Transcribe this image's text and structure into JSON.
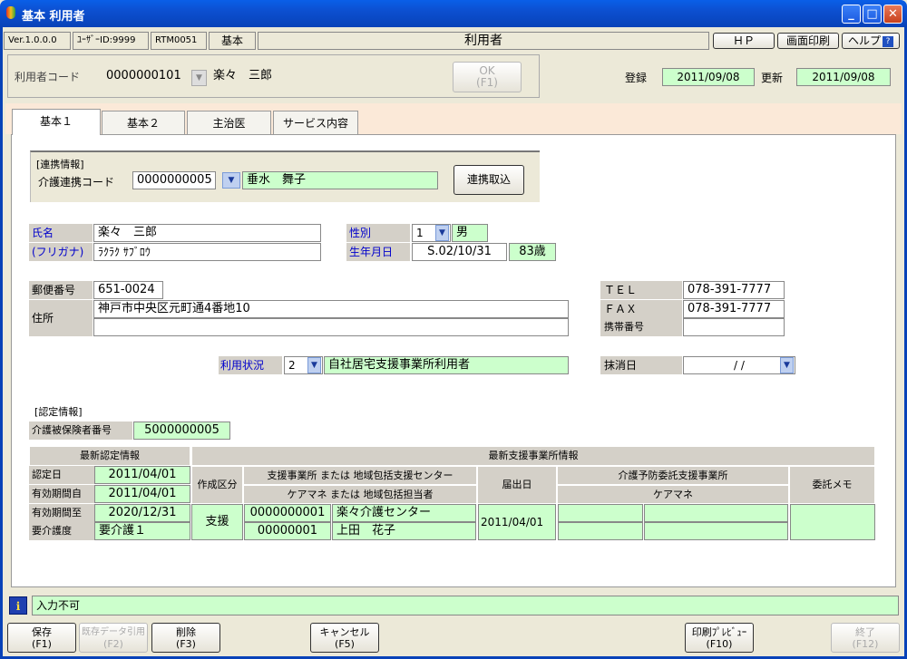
{
  "window": {
    "title": "基本 利用者"
  },
  "topbar": {
    "version": "Ver.1.0.0.0",
    "user_id": "ﾕｰｻﾞｰID:9999",
    "screen_code": "RTM0051",
    "category": "基本",
    "screen_name": "利用者",
    "hp": "ＨＰ",
    "print": "画面印刷",
    "help": "ヘルプ"
  },
  "header": {
    "user_code_label": "利用者コード",
    "user_code": "0000000101",
    "user_name": "楽々　三郎",
    "ok_label": "OK",
    "ok_key": "(F1)",
    "reg_label": "登録",
    "reg_date": "2011/09/08",
    "upd_label": "更新",
    "upd_date": "2011/09/08"
  },
  "tabs": [
    "基本１",
    "基本２",
    "主治医",
    "サービス内容"
  ],
  "renkei": {
    "group": "[連携情報]",
    "code_label": "介護連携コード",
    "code": "0000000005",
    "name": "垂水　舞子",
    "button": "連携取込"
  },
  "person": {
    "name_label": "氏名",
    "name": "楽々　三郎",
    "kana_label": "(フリガナ)",
    "kana": "ﾗｸﾗｸ ｻﾌﾞﾛｳ",
    "sex_label": "性別",
    "sex_code": "1",
    "sex": "男",
    "birth_label": "生年月日",
    "birth": "S.02/10/31",
    "age": "83歳"
  },
  "address": {
    "zip_label": "郵便番号",
    "zip": "651-0024",
    "addr_label": "住所",
    "addr1": "神戸市中央区元町通4番地10",
    "addr2": "",
    "tel_label": "ＴＥＬ",
    "tel": "078-391-7777",
    "fax_label": "ＦＡＸ",
    "fax": "078-391-7777",
    "mobile_label": "携帯番号",
    "mobile": ""
  },
  "status": {
    "label": "利用状況",
    "code": "2",
    "text": "自社居宅支援事業所利用者",
    "delete_label": "抹消日",
    "delete_date": "/ /"
  },
  "nintei": {
    "group": "[認定情報]",
    "insured_label": "介護被保険者番号",
    "insured_no": "5000000005",
    "latest_header": "最新認定情報",
    "date_label": "認定日",
    "date": "2011/04/01",
    "from_label": "有効期間自",
    "from": "2011/04/01",
    "to_label": "有効期間至",
    "to": "2020/12/31",
    "level_label": "要介護度",
    "level": "要介護１",
    "support_header": "最新支援事業所情報",
    "kubun_label": "作成区分",
    "kubun": "支援",
    "office_label": "支援事業所 または 地域包括支援センター",
    "caremgr_label": "ケアマネ または 地域包括担当者",
    "office_code": "0000000001",
    "office_name": "楽々介護センター",
    "caremgr_code": "00000001",
    "caremgr_name": "上田　花子",
    "filed_label": "届出日",
    "filed_date": "2011/04/01",
    "yobo_label": "介護予防委託支援事業所",
    "yobo_caremgr_label": "ケアマネ",
    "memo_label": "委託メモ"
  },
  "message": {
    "text": "入力不可"
  },
  "fkeys": [
    {
      "label": "保存",
      "key": "(F1)",
      "enabled": true
    },
    {
      "label": "既存データ引用",
      "key": "(F2)",
      "enabled": false
    },
    {
      "label": "削除",
      "key": "(F3)",
      "enabled": true
    },
    {
      "label": "キャンセル",
      "key": "(F5)",
      "enabled": true
    },
    {
      "label": "印刷ﾌﾟﾚﾋﾞｭｰ",
      "key": "(F10)",
      "enabled": true
    },
    {
      "label": "終了",
      "key": "(F12)",
      "enabled": false
    }
  ],
  "colors": {
    "title_blue": "#0842b8",
    "readonly_green": "#ccffcc",
    "panel": "#ece9d8",
    "tab_area": "#fbe9d8"
  }
}
